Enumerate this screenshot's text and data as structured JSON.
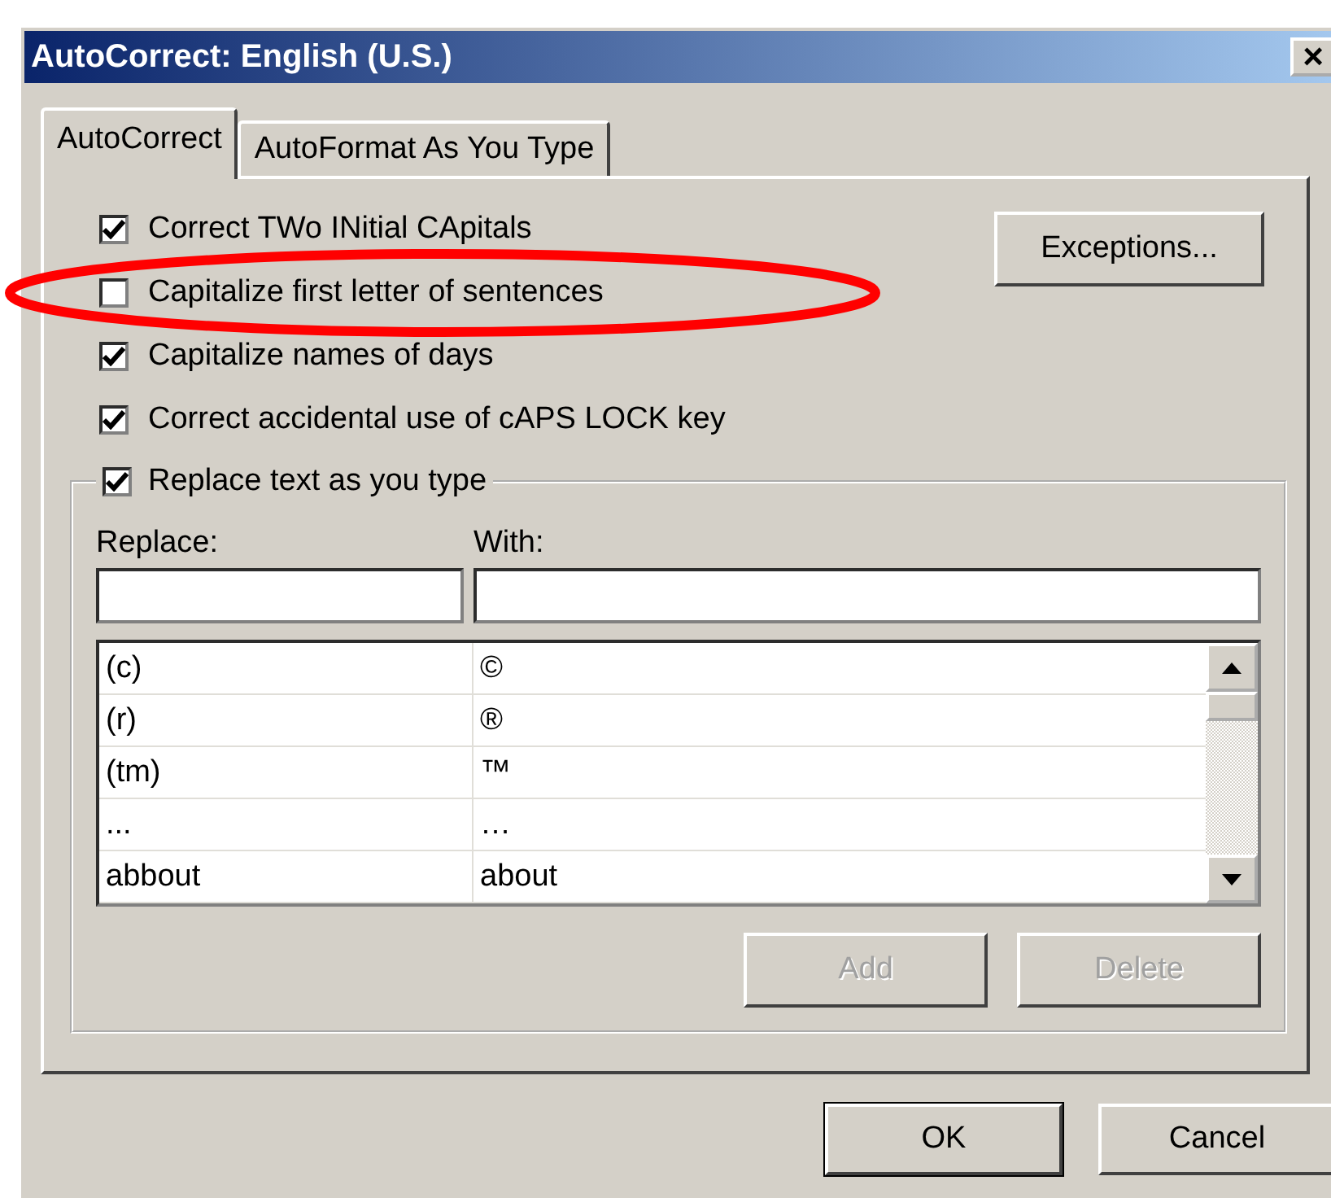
{
  "window": {
    "title": "AutoCorrect: English (U.S.)",
    "close": "×"
  },
  "tabs": [
    {
      "label": "AutoCorrect",
      "selected": true
    },
    {
      "label": "AutoFormat As You Type",
      "selected": false
    }
  ],
  "options": [
    {
      "label": "Correct TWo INitial CApitals",
      "checked": true
    },
    {
      "label": "Capitalize first letter of sentences",
      "checked": false
    },
    {
      "label": "Capitalize names of days",
      "checked": true
    },
    {
      "label": "Correct accidental use of cAPS LOCK key",
      "checked": true
    }
  ],
  "exceptions_button": "Exceptions...",
  "replace_group": {
    "label": "Replace text as you type",
    "checked": true,
    "replace_label": "Replace:",
    "with_label": "With:",
    "rows": [
      {
        "replace": "(c)",
        "with": "©"
      },
      {
        "replace": "(r)",
        "with": "®"
      },
      {
        "replace": "(tm)",
        "with": "™"
      },
      {
        "replace": "...",
        "with": "…"
      },
      {
        "replace": "abbout",
        "with": "about"
      }
    ],
    "buttons": [
      {
        "label": "Add",
        "disabled": true
      },
      {
        "label": "Delete",
        "disabled": true
      }
    ]
  },
  "footer_buttons": [
    {
      "label": "OK",
      "default": true
    },
    {
      "label": "Cancel",
      "default": false
    }
  ],
  "annotation": {
    "kind": "ellipse",
    "color": "#ff0000"
  }
}
